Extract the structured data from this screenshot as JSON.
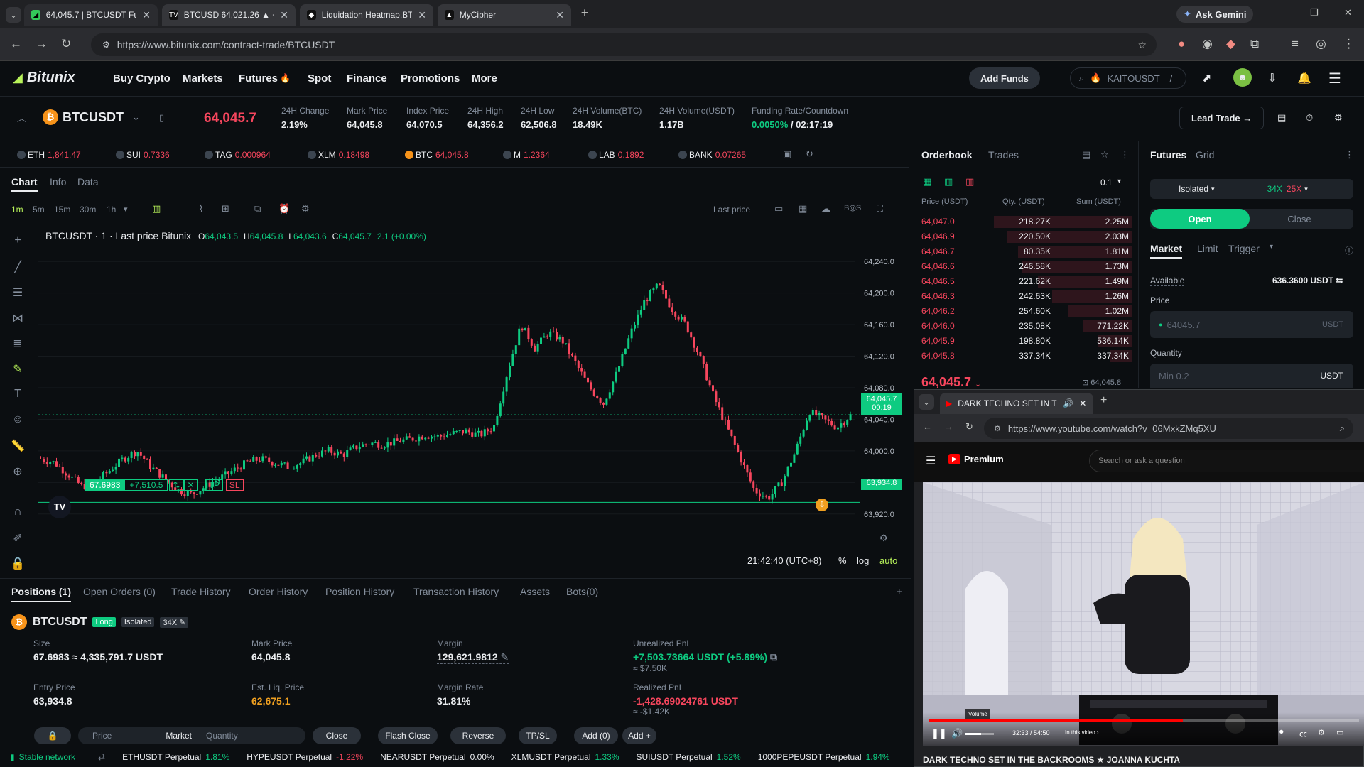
{
  "browser": {
    "tabs": [
      {
        "title": "64,045.7 | BTCUSDT Futures Exch",
        "icon": "bitunix-icon"
      },
      {
        "title": "BTCUSD 64,021.26 ▲ +0.23% 3",
        "icon": "tradingview-icon"
      },
      {
        "title": "Liquidation Heatmap,BTC Liquid",
        "icon": "coinglass-icon"
      },
      {
        "title": "MyCipher",
        "icon": "mycipher-icon"
      }
    ],
    "ask_gemini": "Ask Gemini",
    "url": "https://www.bitunix.com/contract-trade/BTCUSDT"
  },
  "nav": {
    "logo": "Bitunix",
    "items": [
      "Buy Crypto",
      "Markets",
      "Futures",
      "Spot",
      "Finance",
      "Promotions",
      "More"
    ],
    "add_funds": "Add Funds",
    "search_value": "KAITOUSDT"
  },
  "ticker": {
    "symbol": "BTCUSDT",
    "price": "64,045.7",
    "stats": [
      {
        "label": "24H Change",
        "value": "2.19%",
        "color": "green"
      },
      {
        "label": "Mark Price",
        "value": "64,045.8",
        "color": "white"
      },
      {
        "label": "Index Price",
        "value": "64,070.5",
        "color": "white"
      },
      {
        "label": "24H High",
        "value": "64,356.2",
        "color": "white"
      },
      {
        "label": "24H Low",
        "value": "62,506.8",
        "color": "white"
      },
      {
        "label": "24H Volume(BTC)",
        "value": "18.49K",
        "color": "white"
      },
      {
        "label": "24H Volume(USDT)",
        "value": "1.17B",
        "color": "white"
      }
    ],
    "funding_label": "Funding Rate/Countdown",
    "funding_rate": "0.0050%",
    "funding_countdown": "/ 02:17:19",
    "lead_trade": "Lead Trade →"
  },
  "favorites": [
    {
      "sym": "ETH",
      "val": "1,841.47",
      "dir": "down"
    },
    {
      "sym": "SUI",
      "val": "0.7336",
      "dir": "down"
    },
    {
      "sym": "TAG",
      "val": "0.000964",
      "dir": "down"
    },
    {
      "sym": "XLM",
      "val": "0.18498",
      "dir": "down"
    },
    {
      "sym": "BTC",
      "val": "64,045.8",
      "dir": "down"
    },
    {
      "sym": "M",
      "val": "1.2364",
      "dir": "down"
    },
    {
      "sym": "LAB",
      "val": "0.1892",
      "dir": "down"
    },
    {
      "sym": "BANK",
      "val": "0.07265",
      "dir": "down"
    }
  ],
  "chart_tabs": [
    "Chart",
    "Info",
    "Data"
  ],
  "intervals": [
    "1m",
    "5m",
    "15m",
    "30m",
    "1h"
  ],
  "last_price_label": "Last price",
  "chart_data": {
    "type": "candlestick",
    "title": "BTCUSDT · 1 · Last price Bitunix",
    "ohlc_text": {
      "o": "64,043.5",
      "h": "64,045.8",
      "l": "64,043.6",
      "c": "64,045.7",
      "chg": "2.1 (+0.00%)"
    },
    "x_ticks": [
      "16:00",
      "17:00",
      "18:00",
      "19:00",
      "20:00",
      "21:00",
      "22:00",
      "23:00"
    ],
    "y_ticks": [
      "64,240.0",
      "64,200.0",
      "64,160.0",
      "64,120.0",
      "64,080.0",
      "64,040.0",
      "64,000.0",
      "63,960.0",
      "63,920.0"
    ],
    "ylim": [
      63900,
      64260
    ],
    "last_price_tag": "64,045.7",
    "last_price_timer": "00:19",
    "entry_price_tag": "63,934.8",
    "close_series": [
      63990,
      63985,
      63970,
      63955,
      63960,
      63975,
      63990,
      64000,
      63980,
      63965,
      63950,
      63945,
      63955,
      63965,
      63975,
      63985,
      63990,
      63985,
      63980,
      63985,
      63995,
      64000,
      63995,
      64005,
      64010,
      64008,
      64012,
      64015,
      64020,
      64018,
      64022,
      64025,
      64020,
      64030,
      64100,
      64160,
      64130,
      64150,
      64140,
      64110,
      64080,
      64060,
      64100,
      64150,
      64190,
      64210,
      64180,
      64160,
      64120,
      64070,
      64030,
      63990,
      63950,
      63940,
      63960,
      64000,
      64050,
      64040,
      64030,
      64045
    ],
    "position_label": {
      "qty": "67.6983",
      "pnl": "+7,510.5"
    },
    "timestamp": "21:42:40 (UTC+8)",
    "scale_opts": [
      "%",
      "log",
      "auto"
    ]
  },
  "orderbook": {
    "tabs": [
      "Orderbook",
      "Trades"
    ],
    "step": "0.1",
    "headers": [
      "Price (USDT)",
      "Qty. (USDT)",
      "Sum (USDT)"
    ],
    "asks": [
      [
        "64,047.0",
        "218.27K",
        "2.25M",
        0.97
      ],
      [
        "64,046.9",
        "220.50K",
        "2.03M",
        0.88
      ],
      [
        "64,046.7",
        "80.35K",
        "1.81M",
        0.8
      ],
      [
        "64,046.6",
        "246.58K",
        "1.73M",
        0.77
      ],
      [
        "64,046.5",
        "221.62K",
        "1.49M",
        0.66
      ],
      [
        "64,046.3",
        "242.63K",
        "1.26M",
        0.56
      ],
      [
        "64,046.2",
        "254.60K",
        "1.02M",
        0.45
      ],
      [
        "64,046.0",
        "235.08K",
        "771.22K",
        0.34
      ],
      [
        "64,045.9",
        "198.80K",
        "536.14K",
        0.24
      ],
      [
        "64,045.8",
        "337.34K",
        "337.34K",
        0.15
      ]
    ],
    "last": "64,045.7 ↓",
    "mark": "64,045.8"
  },
  "trade": {
    "tabs": [
      "Futures",
      "Grid"
    ],
    "margin_mode": "Isolated",
    "leverage_long": "34X",
    "leverage_short": "25X",
    "open": "Open",
    "close": "Close",
    "order_types": [
      "Market",
      "Limit",
      "Trigger"
    ],
    "available_label": "Available",
    "available": "636.3600 USDT ⇆",
    "price_label": "Price",
    "price_placeholder": "64045.7",
    "price_unit": "USDT",
    "qty_label": "Quantity",
    "qty_placeholder": "Min 0.2",
    "qty_unit": "USDT"
  },
  "positions": {
    "tabs": [
      "Positions (1)",
      "Open Orders (0)",
      "Trade History",
      "Order History",
      "Position History",
      "Transaction History",
      "Assets",
      "Bots(0)"
    ],
    "symbol": "BTCUSDT",
    "side": "Long",
    "mode": "Isolated",
    "leverage": "34X",
    "fields": {
      "size_label": "Size",
      "size": "67.6983 ≈ 4,335,791.7 USDT",
      "mark_label": "Mark Price",
      "mark": "64,045.8",
      "margin_label": "Margin",
      "margin": "129,621.9812",
      "upnl_label": "Unrealized PnL",
      "upnl": "+7,503.73664 USDT (+5.89%)",
      "upnl_sub": "≈ $7.50K",
      "entry_label": "Entry Price",
      "entry": "63,934.8",
      "liq_label": "Est. Liq. Price",
      "liq": "62,675.1",
      "mrate_label": "Margin Rate",
      "mrate": "31.81%",
      "rpnl_label": "Realized PnL",
      "rpnl": "-1,428.69024761 USDT",
      "rpnl_sub": "≈ -$1.42K"
    },
    "actions": {
      "price": "Price",
      "market": "Market",
      "quantity": "Quantity",
      "close": "Close",
      "flash_close": "Flash Close",
      "reverse": "Reverse",
      "tpsl": "TP/SL",
      "add0": "Add  (0)",
      "add": "Add +"
    }
  },
  "statusbar": {
    "network": "Stable network",
    "items": [
      {
        "name": "ETHUSDT Perpetual",
        "chg": "1.81%",
        "dir": "up"
      },
      {
        "name": "HYPEUSDT Perpetual",
        "chg": "-1.22%",
        "dir": "down"
      },
      {
        "name": "NEARUSDT Perpetual",
        "chg": "0.00%",
        "dir": "flat"
      },
      {
        "name": "XLMUSDT Perpetual",
        "chg": "1.33%",
        "dir": "up"
      },
      {
        "name": "SUIUSDT Perpetual",
        "chg": "1.52%",
        "dir": "up"
      },
      {
        "name": "1000PEPEUSDT Perpetual",
        "chg": "1.94%",
        "dir": "up"
      }
    ]
  },
  "youtube": {
    "tab_title": "DARK TECHNO SET IN THE B",
    "url": "https://www.youtube.com/watch?v=06MxkZMq5XU",
    "premium": "Premium",
    "search_placeholder": "Search or ask a question",
    "time": "32:33 / 54:50",
    "chapter": "In this video",
    "volume_tip": "Volume",
    "progress_pct": 59,
    "video_title": "DARK TECHNO SET IN THE BACKROOMS ★ JOANNA KUCHTA"
  }
}
